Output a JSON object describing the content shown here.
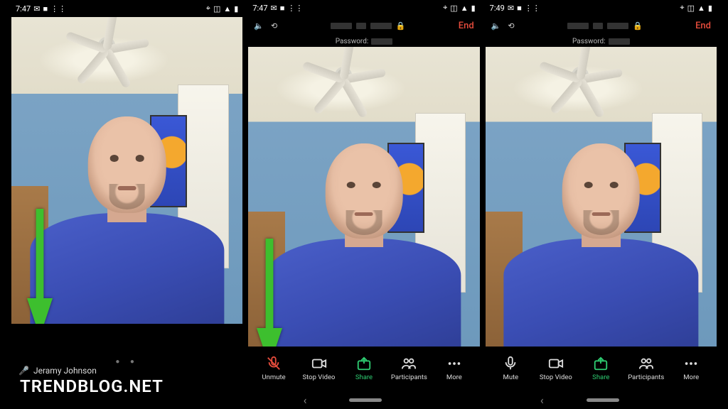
{
  "watermark": "TRENDBLOG.NET",
  "screens": [
    {
      "time": "7:47",
      "participant_name": "Jeramy Johnson",
      "show_arrow": true,
      "mode": "minimal"
    },
    {
      "time": "7:47",
      "end_label": "End",
      "password_label": "Password:",
      "show_arrow": true,
      "mode": "full",
      "toolbar": [
        {
          "label": "Unmute",
          "icon": "mic-off",
          "muted": true
        },
        {
          "label": "Stop Video",
          "icon": "video"
        },
        {
          "label": "Share",
          "icon": "share",
          "accent": true
        },
        {
          "label": "Participants",
          "icon": "people"
        },
        {
          "label": "More",
          "icon": "more"
        }
      ]
    },
    {
      "time": "7:49",
      "end_label": "End",
      "password_label": "Password:",
      "show_arrow": false,
      "mode": "full",
      "toolbar": [
        {
          "label": "Mute",
          "icon": "mic"
        },
        {
          "label": "Stop Video",
          "icon": "video"
        },
        {
          "label": "Share",
          "icon": "share",
          "accent": true
        },
        {
          "label": "Participants",
          "icon": "people"
        },
        {
          "label": "More",
          "icon": "more"
        }
      ]
    }
  ]
}
